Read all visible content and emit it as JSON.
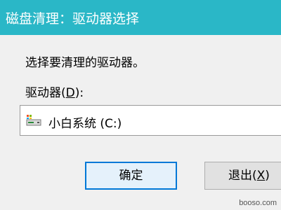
{
  "window": {
    "title": "磁盘清理：驱动器选择"
  },
  "dialog": {
    "instruction": "选择要清理的驱动器。",
    "drive_label_prefix": "驱动器(",
    "drive_label_mnemonic": "D",
    "drive_label_suffix": "):",
    "selected_drive": "小白系统 (C:)",
    "drive_icon": "hard-drive-icon"
  },
  "buttons": {
    "ok_label": "确定",
    "exit_label_prefix": "退出(",
    "exit_label_mnemonic": "X",
    "exit_label_suffix": ")"
  },
  "watermark": "booso.com",
  "colors": {
    "titlebar": "#2ab7c7",
    "dialog_bg": "#f0f0f0",
    "focus_border": "#0078d7"
  }
}
